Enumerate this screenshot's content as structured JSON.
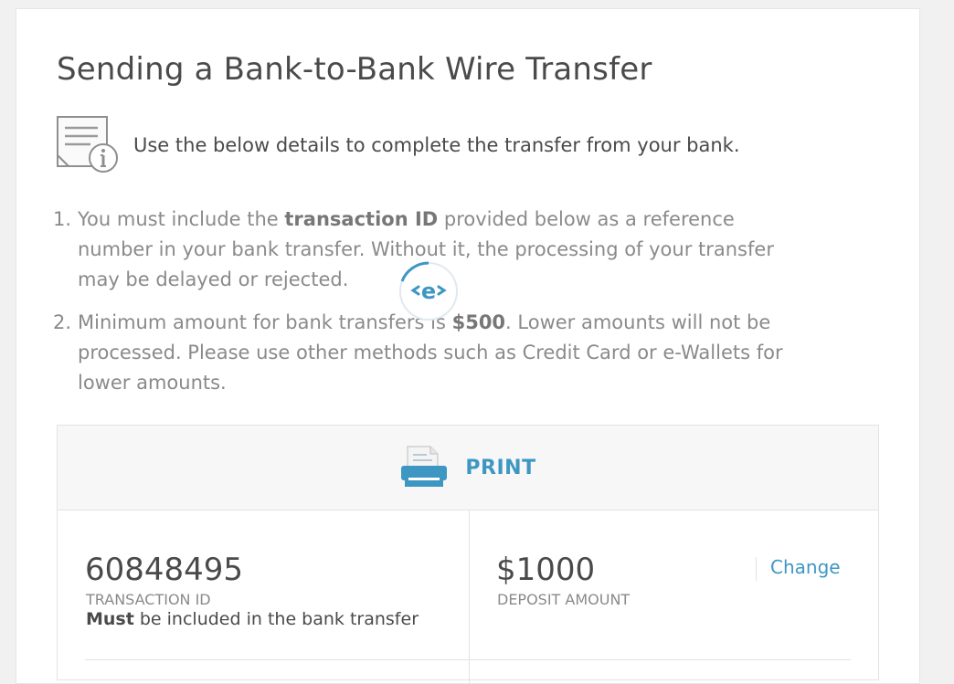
{
  "page": {
    "title": "Sending a Bank-to-Bank Wire Transfer",
    "intro": "Use the below details to complete the transfer from your bank."
  },
  "rules": [
    {
      "number": "1.",
      "before": "You must include the ",
      "bold": "transaction ID",
      "after": " provided below as a reference number in your bank transfer. Without it, the processing of your transfer may be delayed or rejected."
    },
    {
      "number": "2.",
      "before": "Minimum amount for bank transfers is ",
      "bold": "$500",
      "after": ". Lower amounts will not be processed. Please use other methods such as Credit Card or e-Wallets for lower amounts."
    }
  ],
  "loader": {
    "glyph": "e",
    "icon": "loading-spinner-icon"
  },
  "print": {
    "label": "PRINT",
    "icon": "printer-icon"
  },
  "transaction": {
    "value": "60848495",
    "label": "TRANSACTION ID",
    "note_bold": "Must",
    "note_rest": " be included in the bank transfer"
  },
  "deposit": {
    "value": "$1000",
    "label": "DEPOSIT AMOUNT",
    "change_label": "Change"
  },
  "colors": {
    "accent": "#3e97c3",
    "heading": "#4a4a4a",
    "muted": "#8a8a8a",
    "background": "#f1f1f1"
  }
}
